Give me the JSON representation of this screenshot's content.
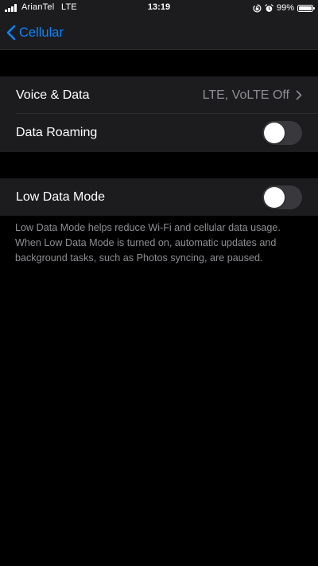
{
  "status_bar": {
    "carrier": "ArianTel",
    "network": "LTE",
    "time": "13:19",
    "battery_percent": "99%",
    "battery_level": 0.99,
    "icons": [
      "signal-icon",
      "rotation-lock-icon",
      "alarm-icon",
      "battery-icon"
    ]
  },
  "nav": {
    "back_label": "Cellular",
    "back_icon": "chevron-left-icon"
  },
  "settings": {
    "voice_data": {
      "label": "Voice & Data",
      "value": "LTE, VoLTE Off"
    },
    "data_roaming": {
      "label": "Data Roaming",
      "enabled": false
    },
    "low_data_mode": {
      "label": "Low Data Mode",
      "enabled": false,
      "description": "Low Data Mode helps reduce Wi-Fi and cellular data usage. When Low Data Mode is turned on, automatic updates and background tasks, such as Photos syncing, are paused."
    }
  },
  "colors": {
    "background": "#000000",
    "cell": "#1c1c1e",
    "accent": "#0a84ff",
    "secondary_text": "#8e8e93",
    "toggle_off": "#39393d"
  }
}
